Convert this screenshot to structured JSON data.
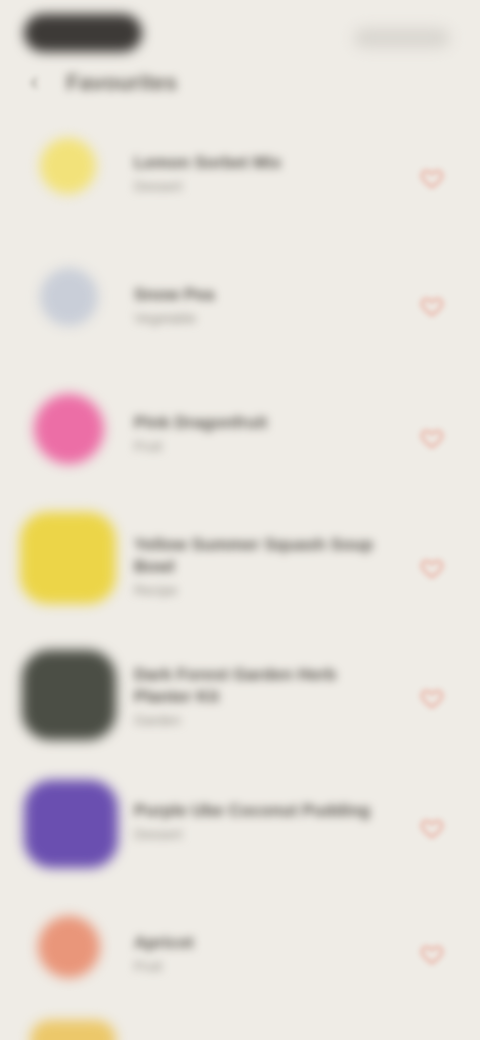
{
  "header": {
    "title": "Favourites",
    "back_glyph": "‹"
  },
  "colors": {
    "background": "#efece6",
    "accent_heart": "#e89a8a"
  },
  "items": [
    {
      "title": "Lemon Sorbet Mix",
      "subtitle": "Dessert",
      "thumb_color": "#f2e27a",
      "icon": "heart-outline-icon"
    },
    {
      "title": "Snow Pea",
      "subtitle": "Vegetable",
      "thumb_color": "#c9ced8",
      "icon": "heart-outline-icon"
    },
    {
      "title": "Pink Dragonfruit",
      "subtitle": "Fruit",
      "thumb_color": "#ec6ea6",
      "icon": "heart-outline-icon"
    },
    {
      "title": "Yellow Summer Squash Soup Bowl",
      "subtitle": "Recipe",
      "thumb_color": "#ecd548",
      "icon": "heart-outline-icon"
    },
    {
      "title": "Dark Forest Garden Herb Planter Kit",
      "subtitle": "Garden",
      "thumb_color": "#4b4e45",
      "icon": "heart-outline-icon"
    },
    {
      "title": "Purple Ube Coconut Pudding",
      "subtitle": "Dessert",
      "thumb_color": "#6a4fb0",
      "icon": "heart-outline-icon"
    },
    {
      "title": "Apricot",
      "subtitle": "Fruit",
      "thumb_color": "#e9967a",
      "icon": "heart-outline-icon"
    }
  ]
}
